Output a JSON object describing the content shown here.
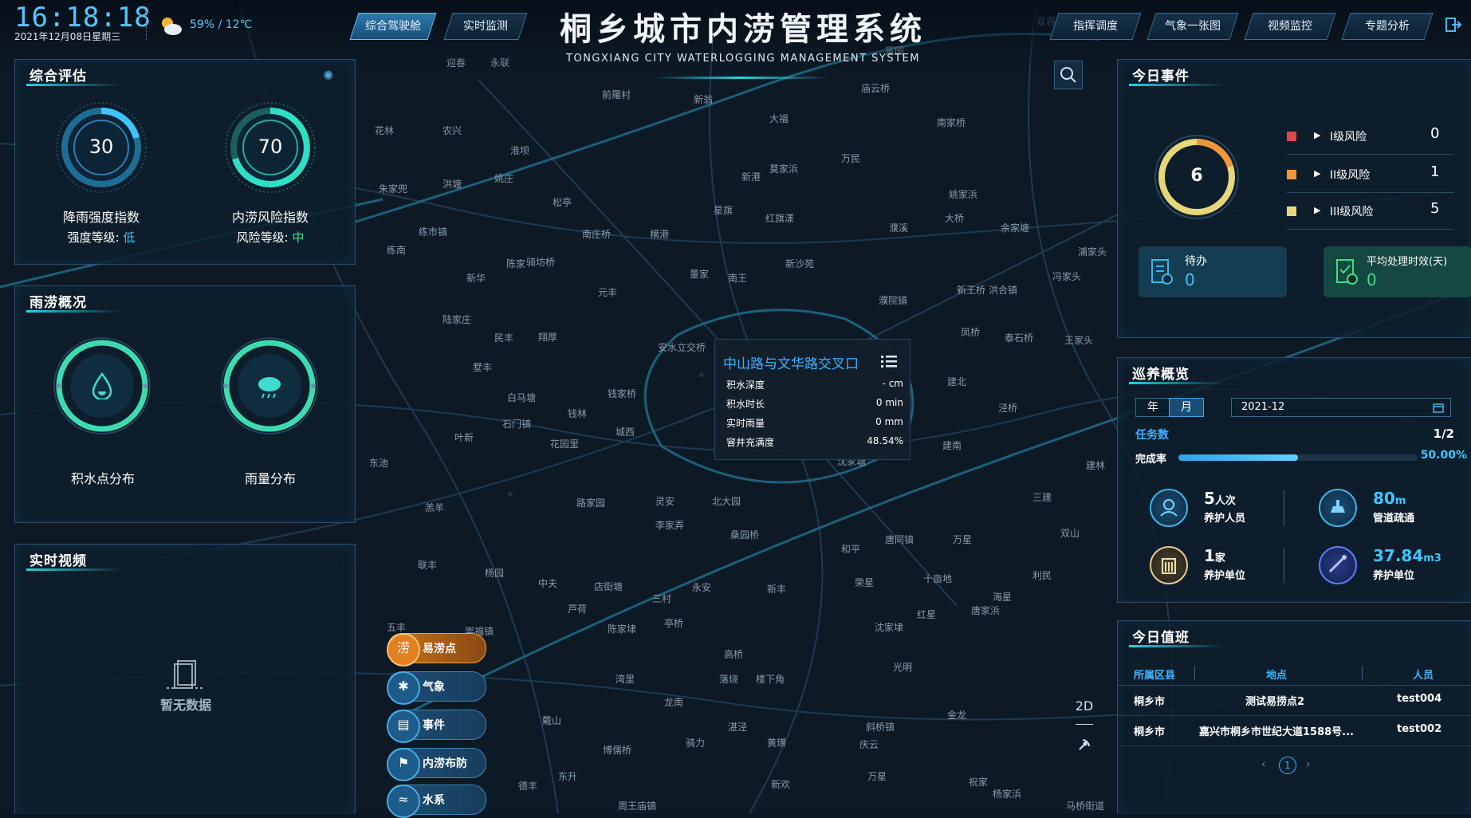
{
  "header": {
    "time": "16:18:18",
    "date": "2021年12月08日星期三",
    "weather": "59% / 12℃",
    "title": "桐乡城市内涝管理系统",
    "subtitle": "TONGXIANG CITY WATERLOGGING MANAGEMENT SYSTEM",
    "left_tabs": [
      "综合驾驶舱",
      "实时监测"
    ],
    "right_tabs": [
      "指挥调度",
      "气象一张图",
      "视频监控",
      "专题分析"
    ]
  },
  "assessment": {
    "title": "综合评估",
    "rain_index_value": "30",
    "rain_index_label": "降雨强度指数",
    "rain_level_label": "强度等级:",
    "rain_level_value": "低",
    "risk_index_value": "70",
    "risk_index_label": "内涝风险指数",
    "risk_level_label": "风险等级:",
    "risk_level_value": "中"
  },
  "overview": {
    "title": "雨涝概况",
    "left_label": "积水点分布",
    "right_label": "雨量分布"
  },
  "video": {
    "title": "实时视频",
    "empty_text": "暂无数据"
  },
  "popup": {
    "title": "中山路与文华路交叉口",
    "rows": [
      {
        "k": "积水深度",
        "v": "- cm"
      },
      {
        "k": "积水时长",
        "v": "0 min"
      },
      {
        "k": "实时雨量",
        "v": "0 mm"
      },
      {
        "k": "窨井充满度",
        "v": "48.54%"
      }
    ]
  },
  "layers": [
    "易涝点",
    "气象",
    "事件",
    "内涝布防",
    "水系"
  ],
  "layer_icons": [
    "涝",
    "✱",
    "▤",
    "⚑",
    "≈"
  ],
  "view_toggle": "2D",
  "events": {
    "title": "今日事件",
    "total": "6",
    "risks": [
      {
        "label": "I级风险",
        "value": "0",
        "color": "#e8454a"
      },
      {
        "label": "II级风险",
        "value": "1",
        "color": "#f0953a"
      },
      {
        "label": "III级风险",
        "value": "5",
        "color": "#e7d67a"
      }
    ],
    "pending_label": "待办",
    "pending_value": "0",
    "avg_label": "平均处理时效(天)",
    "avg_value": "0"
  },
  "patrol": {
    "title": "巡养概览",
    "tab_year": "年",
    "tab_month": "月",
    "month_value": "2021-12",
    "tasks_label": "任务数",
    "tasks_value": "1/2",
    "completion_label": "完成率",
    "completion_value": "50.00%",
    "completion_fraction": 0.5,
    "stats": [
      {
        "num": "5",
        "unit": "人次",
        "label": "养护人员",
        "color": "#ffffff"
      },
      {
        "num": "80",
        "unit": "m",
        "label": "管道疏通",
        "color": "#3fc4ff"
      },
      {
        "num": "1",
        "unit": "家",
        "label": "养护单位",
        "color": "#ffffff"
      },
      {
        "num": "37.84",
        "unit": "m3",
        "label": "养护单位",
        "color": "#3fc4ff"
      }
    ]
  },
  "duty": {
    "title": "今日值班",
    "headers": [
      "所属区县",
      "地点",
      "人员"
    ],
    "rows": [
      [
        "桐乡市",
        "测试易捞点2",
        "test004"
      ],
      [
        "桐乡市",
        "嘉兴市桐乡市世纪大道1588号...",
        "test002"
      ]
    ],
    "page": "1"
  },
  "colors": {
    "accent": "#2ad3e6",
    "low": "#3fc4ff",
    "medium": "#3ddc84"
  }
}
